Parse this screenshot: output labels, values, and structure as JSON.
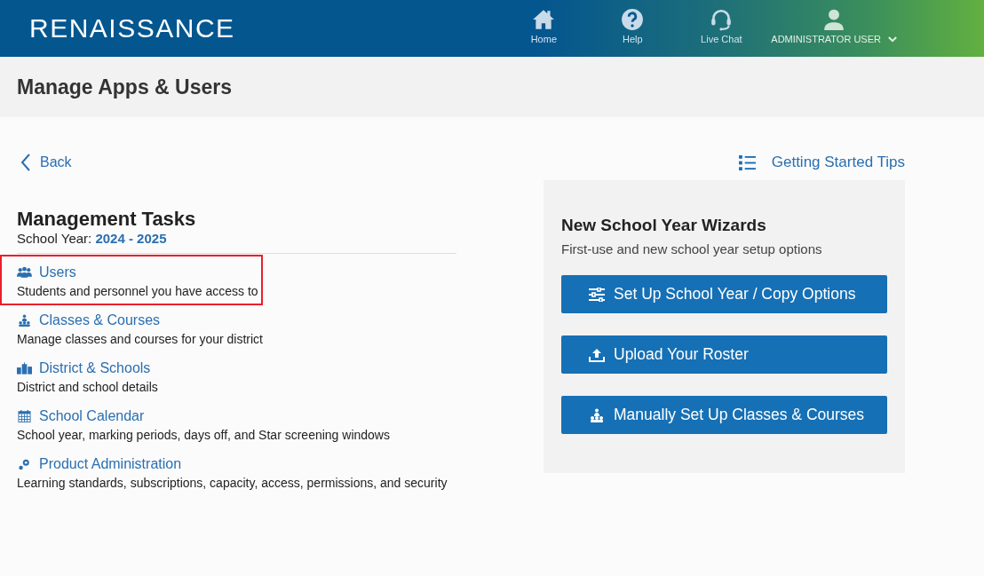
{
  "header": {
    "logo": "RENAISSANCE",
    "nav": [
      {
        "kind": "home",
        "label": "Home"
      },
      {
        "kind": "help",
        "label": "Help"
      },
      {
        "kind": "chat",
        "label": "Live Chat"
      }
    ],
    "user": {
      "label": "ADMINISTRATOR USER"
    }
  },
  "page_title": "Manage Apps & Users",
  "back": "Back",
  "tips": "Getting Started Tips",
  "management": {
    "title": "Management Tasks",
    "year_label": "School Year:",
    "year": "2024 - 2025",
    "tasks": [
      {
        "kind": "users",
        "title": "Users",
        "description": "Students and personnel you have access to",
        "highlighted": true
      },
      {
        "kind": "classes",
        "title": "Classes & Courses",
        "description": "Manage classes and courses for your district",
        "highlighted": false
      },
      {
        "kind": "district",
        "title": "District & Schools",
        "description": "District and school details",
        "highlighted": false
      },
      {
        "kind": "calendar",
        "title": "School Calendar",
        "description": "School year, marking periods, days off, and Star screening windows",
        "highlighted": false
      },
      {
        "kind": "admin",
        "title": "Product Administration",
        "description": "Learning standards, subscriptions, capacity, access, permissions, and security",
        "highlighted": false
      }
    ]
  },
  "wizards": {
    "title": "New School Year Wizards",
    "subtitle": "First-use and new school year setup options",
    "buttons": [
      {
        "kind": "sliders",
        "label": "Set Up School Year / Copy Options"
      },
      {
        "kind": "upload",
        "label": "Upload Your Roster"
      },
      {
        "kind": "classes",
        "label": "Manually Set Up Classes & Courses"
      }
    ]
  }
}
